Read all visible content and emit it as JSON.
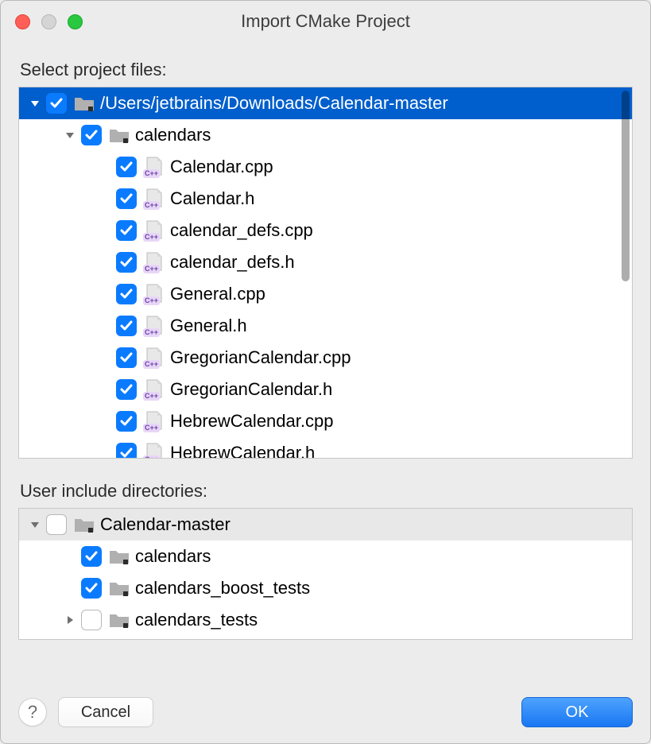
{
  "window": {
    "title": "Import CMake Project"
  },
  "sections": {
    "files_label": "Select project files:",
    "includes_label": "User include directories:"
  },
  "files_tree": {
    "root": {
      "label": "/Users/jetbrains/Downloads/Calendar-master",
      "checked": true,
      "expanded": true,
      "selected": true
    },
    "calendars": {
      "label": "calendars",
      "checked": true,
      "expanded": true
    },
    "items": [
      {
        "label": "Calendar.cpp",
        "checked": true
      },
      {
        "label": "Calendar.h",
        "checked": true
      },
      {
        "label": "calendar_defs.cpp",
        "checked": true
      },
      {
        "label": "calendar_defs.h",
        "checked": true
      },
      {
        "label": "General.cpp",
        "checked": true
      },
      {
        "label": "General.h",
        "checked": true
      },
      {
        "label": "GregorianCalendar.cpp",
        "checked": true
      },
      {
        "label": "GregorianCalendar.h",
        "checked": true
      },
      {
        "label": "HebrewCalendar.cpp",
        "checked": true
      },
      {
        "label": "HebrewCalendar.h",
        "checked": true
      }
    ]
  },
  "includes_tree": {
    "root": {
      "label": "Calendar-master",
      "checked": false,
      "expanded": true
    },
    "items": [
      {
        "label": "calendars",
        "checked": true,
        "expanded": null
      },
      {
        "label": "calendars_boost_tests",
        "checked": true,
        "expanded": null
      },
      {
        "label": "calendars_tests",
        "checked": false,
        "expanded": false
      }
    ]
  },
  "footer": {
    "help": "?",
    "cancel": "Cancel",
    "ok": "OK"
  },
  "icons": {
    "cpp_badge": "C++"
  }
}
